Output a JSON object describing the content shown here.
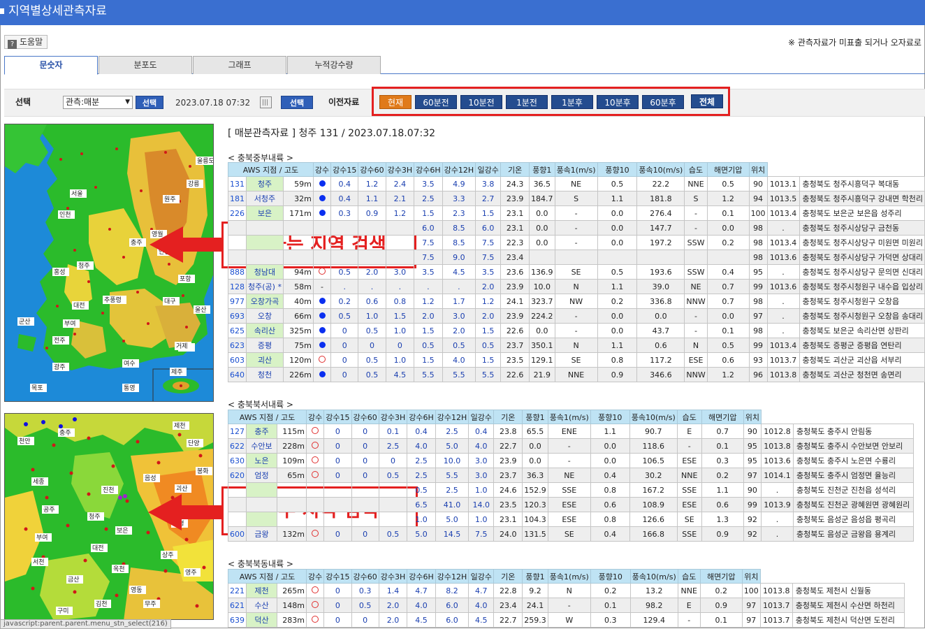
{
  "window": {
    "title": "지역별상세관측자료"
  },
  "help": {
    "label": "도움말",
    "icon": "?"
  },
  "notice": "※ 관측자료가 미표출 되거나 오자료로",
  "tabs": [
    "문숫자",
    "분포도",
    "그래프",
    "누적강수량"
  ],
  "select_bar": {
    "label": "선택",
    "select_value": "관측:매분",
    "select_btn": "선택",
    "datetime": "2023.07.18 07:32",
    "select_btn2": "선택",
    "prev_label": "이전자료"
  },
  "nav_buttons": [
    "현재",
    "60분전",
    "10분전",
    "1분전",
    "1분후",
    "10분후",
    "60분후",
    "전체"
  ],
  "annotations": {
    "region_search": "원하는 지역 검색",
    "detail_search": "세부 지역 검색"
  },
  "status_text": "javascript:parent.parent.menu_stn_select(216)",
  "heading": "[ 매분관측자료 ] 청주 131 / 2023.07.18.07:32",
  "colors": {
    "accent": "#2f5fb8",
    "highlight_red": "#e42020",
    "current_btn": "#e07a1a",
    "header_bg": "#bfe3f4",
    "station_bg": "#d8f2c6"
  },
  "columns": [
    "AWS 지점 / 고도",
    "강수",
    "강수15",
    "강수60",
    "강수3H",
    "강수6H",
    "강수12H",
    "일강수",
    "기온",
    "풍향1",
    "풍속1(m/s)",
    "풍향10",
    "풍속10(m/s)",
    "습도",
    "해면기압",
    "위치"
  ],
  "sections": [
    {
      "title": "< 충북중부내륙 >",
      "rows": [
        [
          "131",
          "청주",
          "59m",
          "●",
          "0.4",
          "1.2",
          "2.4",
          "3.5",
          "4.9",
          "3.8",
          "24.3",
          "36.5",
          "NE",
          "0.5",
          "22.2",
          "NNE",
          "0.5",
          "90",
          "1013.1",
          "충청북도 청주시흥덕구 복대동"
        ],
        [
          "181",
          "서청주",
          "32m",
          "●",
          "0.4",
          "1.1",
          "2.1",
          "2.5",
          "3.3",
          "2.7",
          "23.9",
          "184.7",
          "S",
          "1.1",
          "181.8",
          "S",
          "1.2",
          "94",
          "1013.5",
          "충청북도 청주시흥덕구 강내면 학천리"
        ],
        [
          "226",
          "보은",
          "171m",
          "●",
          "0.3",
          "0.9",
          "1.2",
          "1.5",
          "2.3",
          "1.5",
          "23.1",
          "0.0",
          "-",
          "0.0",
          "276.4",
          "-",
          "0.1",
          "100",
          "1013.4",
          "충청북도 보은군 보은읍 성주리"
        ],
        [
          "",
          "",
          "",
          "",
          "",
          "",
          "",
          "6.0",
          "8.5",
          "6.0",
          "23.1",
          "0.0",
          "-",
          "0.0",
          "147.7",
          "-",
          "0.0",
          "98",
          ".",
          "충청북도 청주시상당구 금천동"
        ],
        [
          "",
          "",
          "",
          "",
          "",
          "",
          "",
          "7.5",
          "8.5",
          "7.5",
          "22.3",
          "0.0",
          "-",
          "0.0",
          "197.2",
          "SSW",
          "0.2",
          "98",
          "1013.4",
          "충청북도 청주시상당구 미원면 미원리"
        ],
        [
          "",
          "",
          "",
          "",
          "",
          "",
          "",
          "7.5",
          "9.0",
          "7.5",
          "23.4",
          "",
          "",
          "",
          "",
          "",
          "",
          "98",
          "1013.6",
          "충청북도 청주시상당구 가덕면 상대리"
        ],
        [
          "888",
          "청남대",
          "94m",
          "○",
          "0.5",
          "2.0",
          "3.0",
          "3.5",
          "4.5",
          "3.5",
          "23.6",
          "136.9",
          "SE",
          "0.5",
          "193.6",
          "SSW",
          "0.4",
          "95",
          ".",
          "충청북도 청주시상당구 문의면 신대리"
        ],
        [
          "128",
          "청주(공) *",
          "58m",
          "-",
          ".",
          ".",
          ".",
          ".",
          ".",
          "2.0",
          "23.9",
          "10.0",
          "N",
          "1.1",
          "39.0",
          "NE",
          "0.7",
          "99",
          "1013.6",
          "충청북도 청주시청원구 내수읍 입상리"
        ],
        [
          "977",
          "오창가곡",
          "40m",
          "●",
          "0.2",
          "0.6",
          "0.8",
          "1.2",
          "1.7",
          "1.2",
          "24.1",
          "323.7",
          "NW",
          "0.2",
          "336.8",
          "NNW",
          "0.7",
          "98",
          ".",
          "충청북도 청주시청원구 오창읍"
        ],
        [
          "693",
          "오창",
          "66m",
          "●",
          "0.5",
          "1.0",
          "1.5",
          "2.0",
          "3.0",
          "2.0",
          "23.9",
          "224.2",
          "-",
          "0.0",
          "0.0",
          "-",
          "0.0",
          "97",
          ".",
          "충청북도 청주시청원구 오창읍 송대리"
        ],
        [
          "625",
          "속리산",
          "325m",
          "●",
          "0",
          "0.5",
          "1.0",
          "1.5",
          "2.0",
          "1.5",
          "22.6",
          "0.0",
          "-",
          "0.0",
          "43.7",
          "-",
          "0.1",
          "98",
          ".",
          "충청북도 보은군 속리산면 상판리"
        ],
        [
          "623",
          "증평",
          "75m",
          "●",
          "0",
          "0",
          "0",
          "0.5",
          "0.5",
          "0.5",
          "23.7",
          "350.1",
          "N",
          "1.1",
          "0.6",
          "N",
          "0.5",
          "99",
          "1013.4",
          "충청북도 증평군 증평읍 연탄리"
        ],
        [
          "603",
          "괴산",
          "120m",
          "○",
          "0",
          "0.5",
          "1.0",
          "1.5",
          "4.0",
          "1.5",
          "23.5",
          "129.1",
          "SE",
          "0.8",
          "117.2",
          "ESE",
          "0.6",
          "93",
          "1013.7",
          "충청북도 괴산군 괴산읍 서부리"
        ],
        [
          "640",
          "청천",
          "226m",
          "●",
          "0",
          "0.5",
          "4.5",
          "5.5",
          "5.5",
          "5.5",
          "22.6",
          "21.9",
          "NNE",
          "0.9",
          "346.6",
          "NNW",
          "1.2",
          "96",
          "1013.8",
          "충청북도 괴산군 청천면 송면리"
        ]
      ]
    },
    {
      "title": "< 충북북서내륙 >",
      "rows": [
        [
          "127",
          "충주",
          "115m",
          "○",
          "0",
          "0",
          "0.1",
          "0.4",
          "2.5",
          "0.4",
          "23.8",
          "65.5",
          "ENE",
          "1.1",
          "90.7",
          "E",
          "0.7",
          "90",
          "1012.8",
          "충청북도 충주시 안림동"
        ],
        [
          "622",
          "수안보",
          "228m",
          "○",
          "0",
          "0",
          "2.5",
          "4.0",
          "5.0",
          "4.0",
          "22.7",
          "0.0",
          "-",
          "0.0",
          "118.6",
          "-",
          "0.1",
          "95",
          "1013.8",
          "충청북도 충주시 수안보면 안보리"
        ],
        [
          "630",
          "노은",
          "109m",
          "○",
          "0",
          "0",
          "0",
          "2.5",
          "10.0",
          "3.0",
          "23.9",
          "0.0",
          "-",
          "0.0",
          "106.5",
          "ESE",
          "0.3",
          "95",
          "1013.6",
          "충청북도 충주시 노은면 수룡리"
        ],
        [
          "620",
          "엄정",
          "65m",
          "○",
          "0",
          "0",
          "0.5",
          "2.5",
          "5.5",
          "3.0",
          "23.7",
          "36.3",
          "NE",
          "0.4",
          "30.2",
          "NNE",
          "0.2",
          "97",
          "1014.1",
          "충청북도 충주시 엄정면 율능리"
        ],
        [
          "",
          "",
          "",
          "",
          "",
          "",
          "",
          "0.5",
          "2.5",
          "1.0",
          "24.6",
          "152.9",
          "SSE",
          "0.8",
          "167.2",
          "SSE",
          "1.1",
          "90",
          ".",
          "충청북도 진천군 진천읍 성석리"
        ],
        [
          "",
          "",
          "",
          "",
          "",
          "",
          "",
          "6.5",
          "41.0",
          "14.0",
          "23.5",
          "120.3",
          "ESE",
          "0.6",
          "108.9",
          "ESE",
          "0.6",
          "99",
          "1013.9",
          "충청북도 진천군 광혜원면 광혜원리"
        ],
        [
          "",
          "",
          "",
          "",
          "",
          "",
          "",
          "1.0",
          "5.0",
          "1.0",
          "23.1",
          "104.3",
          "ESE",
          "0.8",
          "126.6",
          "SE",
          "1.3",
          "92",
          ".",
          "충청북도 음성군 음성읍 평곡리"
        ],
        [
          "600",
          "금왕",
          "132m",
          "○",
          "0",
          "0",
          "0.5",
          "5.0",
          "14.5",
          "7.5",
          "24.0",
          "131.5",
          "SE",
          "0.4",
          "166.8",
          "SSE",
          "0.9",
          "92",
          ".",
          "충청북도 음성군 금왕읍 용계리"
        ]
      ]
    },
    {
      "title": "< 충북북동내륙 >",
      "rows": [
        [
          "221",
          "제천",
          "265m",
          "○",
          "0",
          "0.3",
          "1.4",
          "4.7",
          "8.2",
          "4.7",
          "22.8",
          "9.2",
          "N",
          "0.2",
          "13.2",
          "NNE",
          "0.2",
          "100",
          "1013.8",
          "충청북도 제천시 신월동"
        ],
        [
          "621",
          "수산",
          "148m",
          "○",
          "0",
          "0.5",
          "2.0",
          "4.0",
          "6.0",
          "4.0",
          "23.4",
          "24.1",
          "-",
          "0.1",
          "98.2",
          "E",
          "0.9",
          "97",
          "1013.7",
          "충청북도 제천시 수산면 하천리"
        ],
        [
          "639",
          "덕산",
          "283m",
          "○",
          "0",
          "0",
          "2.0",
          "4.5",
          "6.0",
          "4.5",
          "22.7",
          "259.3",
          "W",
          "0.3",
          "129.4",
          "-",
          "0.1",
          "97",
          "1013.7",
          "충청북도 제천시 덕산면 도전리"
        ]
      ]
    }
  ],
  "map1_labels": [
    "강릉",
    "원주",
    "영월",
    "충주",
    "청주",
    "대전",
    "추풍령",
    "전주",
    "광주",
    "목포",
    "여수",
    "부산",
    "울산",
    "포항",
    "대구",
    "안동",
    "영덕",
    "울릉도",
    "인천",
    "서울",
    "홍성",
    "부여",
    "군산",
    "통영",
    "거제",
    "제주"
  ],
  "map2_labels": [
    "천안",
    "충주",
    "제천",
    "음성",
    "진천",
    "청주",
    "보은",
    "괴산",
    "단양",
    "영동",
    "옥천",
    "대전",
    "금산",
    "무주",
    "서천",
    "부여",
    "공주",
    "세종",
    "문경",
    "상주",
    "김천",
    "구미",
    "봉화",
    "영주"
  ]
}
